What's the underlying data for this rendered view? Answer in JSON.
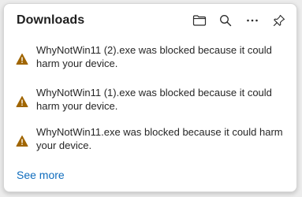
{
  "panel": {
    "title": "Downloads",
    "toolbar": {
      "folder_icon": "folder-icon",
      "search_icon": "search-icon",
      "more_icon": "more-icon",
      "pin_icon": "pin-icon"
    },
    "items": [
      {
        "message": "WhyNotWin11 (2).exe was blocked because it could harm your device."
      },
      {
        "message": "WhyNotWin11 (1).exe was blocked because it could harm your device."
      },
      {
        "message": "WhyNotWin11.exe was blocked because it could harm your device."
      }
    ],
    "see_more_label": "See more"
  },
  "colors": {
    "warning": "#a06500",
    "link": "#0f6cbd",
    "text": "#262626",
    "background": "#ffffff"
  }
}
